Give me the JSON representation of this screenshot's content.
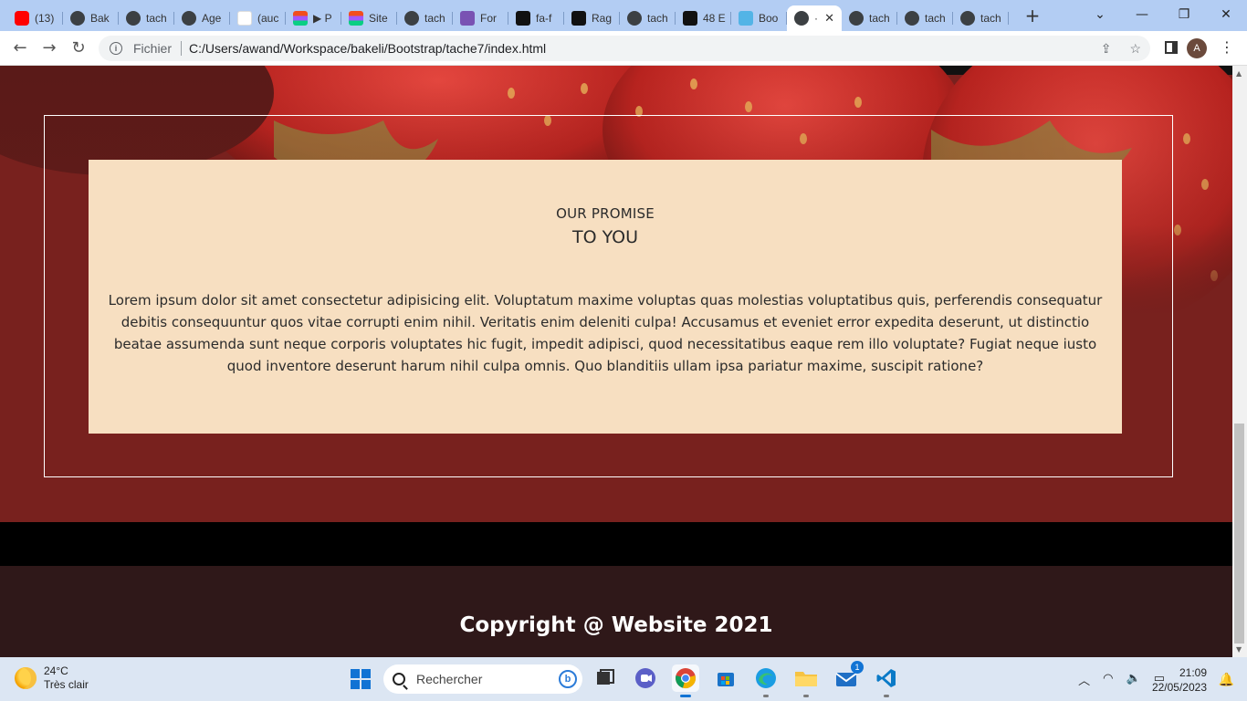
{
  "browser": {
    "tabs": [
      {
        "icon": "youtube-icon",
        "label": "(13)"
      },
      {
        "icon": "bakeli-icon",
        "label": "Bak"
      },
      {
        "icon": "globe-icon",
        "label": "tach"
      },
      {
        "icon": "globe-icon",
        "label": "Age"
      },
      {
        "icon": "gmail-icon",
        "label": "(auc"
      },
      {
        "icon": "figma-icon",
        "label": "▶ P"
      },
      {
        "icon": "figma-icon",
        "label": "Site"
      },
      {
        "icon": "globe-icon",
        "label": "tach"
      },
      {
        "icon": "bootstrap-icon",
        "label": "For"
      },
      {
        "icon": "flag-icon",
        "label": "fa-f"
      },
      {
        "icon": "image-icon",
        "label": "Rag"
      },
      {
        "icon": "globe-icon",
        "label": "tach"
      },
      {
        "icon": "f-icon",
        "label": "48 E"
      },
      {
        "icon": "bd-icon",
        "label": "Boo"
      },
      {
        "icon": "globe-icon",
        "label": "·",
        "active": true
      },
      {
        "icon": "globe-icon",
        "label": "tach"
      },
      {
        "icon": "globe-icon",
        "label": "tach"
      },
      {
        "icon": "globe-icon",
        "label": "tach"
      }
    ],
    "new_tab": "+",
    "address": {
      "scheme_label": "Fichier",
      "url": "C:/Users/awand/Workspace/bakeli/Bootstrap/tache7/index.html"
    },
    "profile_initial": "A"
  },
  "page": {
    "promise": {
      "kicker": "OUR PROMISE",
      "heading": "TO YOU",
      "body": "Lorem ipsum dolor sit amet consectetur adipisicing elit. Voluptatum maxime voluptas quas molestias voluptatibus quis, perferendis consequatur debitis consequuntur quos vitae corrupti enim nihil. Veritatis enim deleniti culpa! Accusamus et eveniet error expedita deserunt, ut distinctio beatae assumenda sunt neque corporis voluptates hic fugit, impedit adipisci, quod necessitatibus eaque rem illo voluptate? Fugiat neque iusto quod inventore deserunt harum nihil culpa omnis. Quo blanditiis ullam ipsa pariatur maxime, suscipit ratione?"
    },
    "footer": {
      "copyright": "Copyright @ Website 2021"
    },
    "colors": {
      "hero_bg": "#78211e",
      "card_bg": "#f7dfc1",
      "footer_bg": "#2f1819"
    }
  },
  "taskbar": {
    "weather": {
      "temp": "24°C",
      "condition": "Très clair"
    },
    "search_placeholder": "Rechercher",
    "mail_badge": "1",
    "clock": {
      "time": "21:09",
      "date": "22/05/2023"
    }
  }
}
